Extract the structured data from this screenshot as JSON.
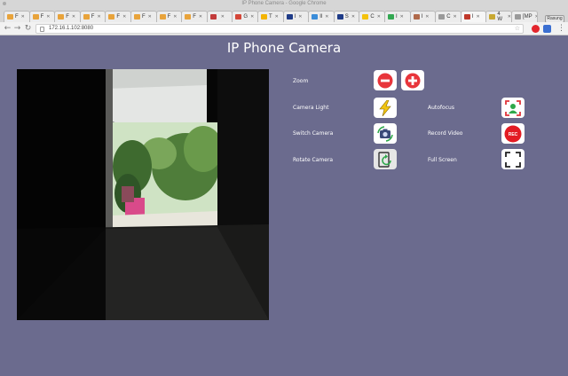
{
  "window": {
    "title": "IP Phone Camera - Google Chrome",
    "profile_label": "Rasung"
  },
  "tabs": [
    {
      "label": "F",
      "favicon": "#e8a33b"
    },
    {
      "label": "F",
      "favicon": "#e8a33b"
    },
    {
      "label": "F",
      "favicon": "#e8a33b"
    },
    {
      "label": "F",
      "favicon": "#e8a33b"
    },
    {
      "label": "F",
      "favicon": "#e8a33b"
    },
    {
      "label": "F",
      "favicon": "#e8a33b"
    },
    {
      "label": "F",
      "favicon": "#e8a33b"
    },
    {
      "label": "F",
      "favicon": "#e8a33b"
    },
    {
      "label": "",
      "favicon": "#c23b3b"
    },
    {
      "label": "G",
      "favicon": "#d44638"
    },
    {
      "label": "T",
      "favicon": "#f4b400"
    },
    {
      "label": "I",
      "favicon": "#1f3c88"
    },
    {
      "label": "Il",
      "favicon": "#3b8dd9"
    },
    {
      "label": "S",
      "favicon": "#1f3c88"
    },
    {
      "label": "C",
      "favicon": "#f4c20d"
    },
    {
      "label": "I",
      "favicon": "#33a852"
    },
    {
      "label": "I",
      "favicon": "#b06a4b"
    },
    {
      "label": "C",
      "favicon": "#9a9a9a"
    },
    {
      "label": "I",
      "favicon": "#c0392b",
      "active": true
    },
    {
      "label": "4 W",
      "favicon": "#c8a832"
    },
    {
      "label": "[MP",
      "favicon": "#9a9a9a"
    }
  ],
  "address_bar": {
    "url": "172.16.1.102:8080"
  },
  "page": {
    "title": "IP Phone Camera",
    "controls": {
      "zoom_label": "Zoom",
      "camera_light_label": "Camera Light",
      "autofocus_label": "Autofocus",
      "switch_camera_label": "Switch Camera",
      "record_video_label": "Record Video",
      "record_badge": "REC",
      "rotate_camera_label": "Rotate Camera",
      "full_screen_label": "Full Screen"
    }
  },
  "icons": {
    "zoom_out": "minus-circle-icon",
    "zoom_in": "plus-circle-icon",
    "camera_light": "lightning-icon",
    "autofocus": "focus-person-icon",
    "switch_camera": "camera-switch-icon",
    "record": "record-icon",
    "rotate": "rotate-icon",
    "fullscreen": "fullscreen-icon"
  },
  "colors": {
    "page_bg": "#6b6b8e",
    "zoom_red": "#e8353b",
    "record_red": "#e31b23",
    "light_yellow": "#f2c511",
    "focus_green": "#2ea84a",
    "focus_red": "#e0343a"
  }
}
